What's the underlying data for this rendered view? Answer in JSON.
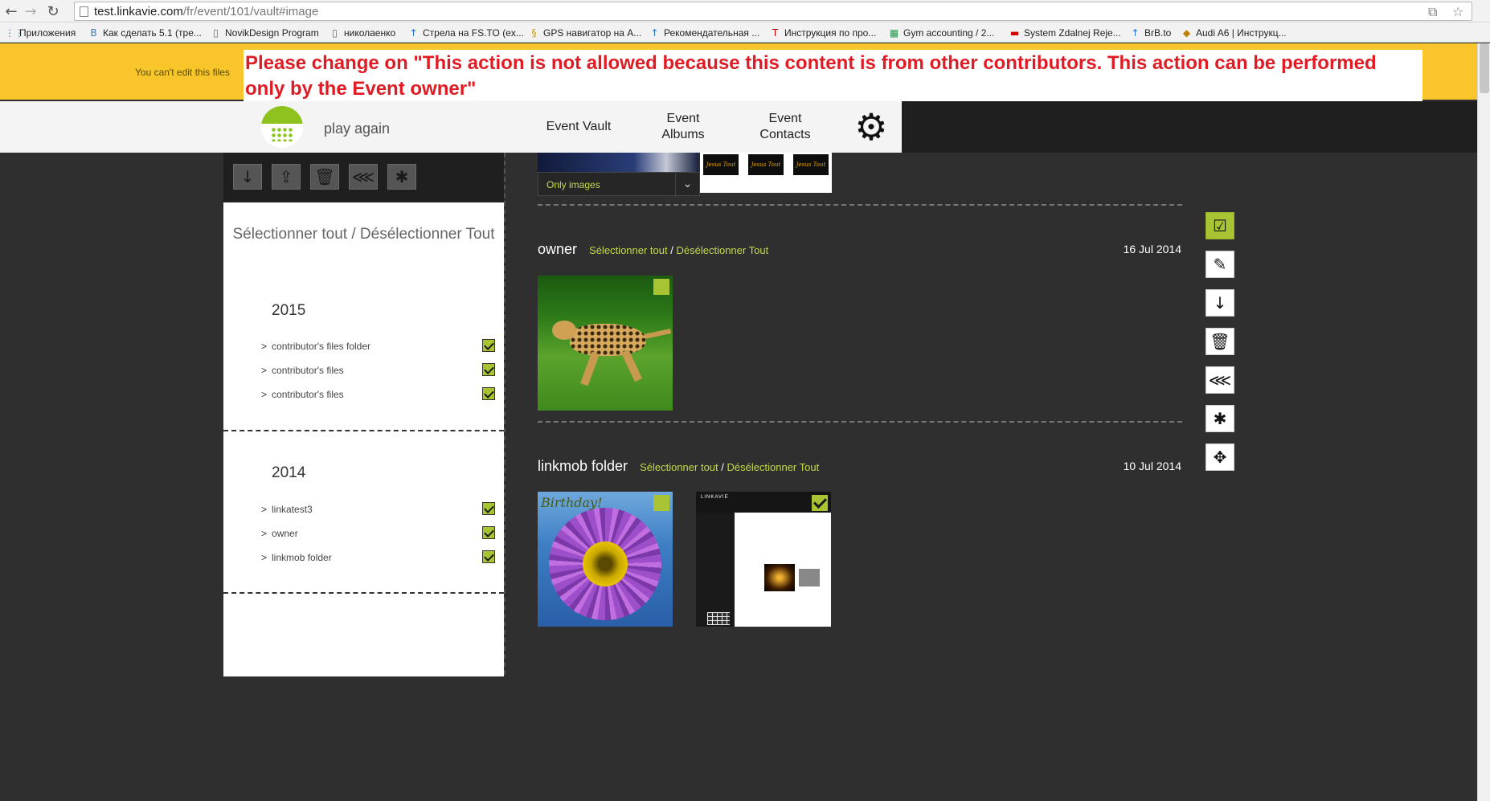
{
  "browser": {
    "back_icon": "←",
    "forward_icon": "→",
    "reload_icon": "↻",
    "url_host": "test.linkavie.com",
    "url_path": "/fr/event/101/vault#image",
    "star_icon": "☆",
    "translate_icon": "⧉"
  },
  "bookmarks": [
    {
      "label": "Приложения",
      "icon": "⋮⋮",
      "color": "#4a78c2"
    },
    {
      "label": "Как сделать 5.1 (тре...",
      "icon": "В",
      "color": "#4a76a8"
    },
    {
      "label": "NovikDesign Program",
      "icon": "▯",
      "color": "#666666"
    },
    {
      "label": "николаенко",
      "icon": "▯",
      "color": "#666666"
    },
    {
      "label": "Стрела на FS.TO (ex...",
      "icon": "↑",
      "color": "#1c6fd0"
    },
    {
      "label": "GPS навигатор на А...",
      "icon": "§",
      "color": "#c79a00"
    },
    {
      "label": "Рекомендательная ...",
      "icon": "↑",
      "color": "#1c6fd0"
    },
    {
      "label": "Инструкция по про...",
      "icon": "T",
      "color": "#c00000"
    },
    {
      "label": "Gym accounting / 2...",
      "icon": "▦",
      "color": "#1e9a4a"
    },
    {
      "label": "System Zdalnej Reje...",
      "icon": "▬",
      "color": "#d00000"
    },
    {
      "label": "BrB.to",
      "icon": "↑",
      "color": "#1c6fd0"
    },
    {
      "label": "Audi A6 | Инструкц...",
      "icon": "◆",
      "color": "#c08000"
    }
  ],
  "notification": {
    "message": "You can't edit this files",
    "annotation": "Please change on \"This action is not allowed because this content is from other contributors. This action can be performed only by the Event owner\""
  },
  "header": {
    "brand": "play again",
    "menu": [
      {
        "label": "Event Vault"
      },
      {
        "label": "Event Albums"
      },
      {
        "label": "Event Contacts"
      }
    ],
    "settings_icon": "⚙"
  },
  "sidebar": {
    "toolbar_icons": [
      "↓",
      "⇪",
      "🗑",
      "⋘",
      "✱"
    ],
    "select_all": "Sélectionner tout / Désélectionner Tout",
    "groups": [
      {
        "year": "2015",
        "folders": [
          "contributor's files folder",
          "contributor's files",
          "contributor's files"
        ]
      },
      {
        "year": "2014",
        "folders": [
          "linkatest3",
          "owner",
          "linkmob folder"
        ]
      }
    ],
    "chevron": ">"
  },
  "main": {
    "filter_label": "Only images",
    "filter_arrow": "⌄",
    "top_thumbs_text": "Jesus Tout",
    "select_all_link": "Sélectionner tout",
    "slash": "/",
    "deselect_all_link": "Désélectionner Tout",
    "sections": [
      {
        "title": "owner",
        "date": "16 Jul 2014"
      },
      {
        "title": "linkmob folder",
        "date": "10 Jul 2014"
      }
    ],
    "birthday_text": "Birthday!",
    "shot_header": "LINKAVIE"
  },
  "actions": {
    "icons": [
      "☑",
      "✎",
      "↓",
      "🗑",
      "⋘",
      "✱",
      "✥"
    ]
  },
  "colors": {
    "accent_green": "#a8c432",
    "notify_yellow": "#f8c62b",
    "annotation_red": "#e01b24"
  }
}
